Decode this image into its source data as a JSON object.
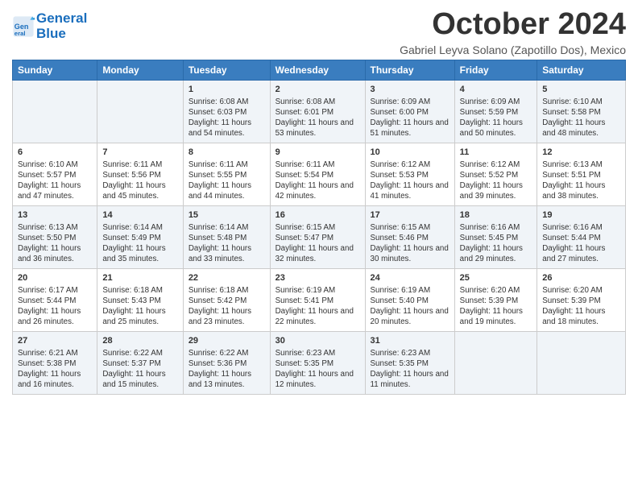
{
  "logo": {
    "line1": "General",
    "line2": "Blue"
  },
  "title": "October 2024",
  "subtitle": "Gabriel Leyva Solano (Zapotillo Dos), Mexico",
  "days_of_week": [
    "Sunday",
    "Monday",
    "Tuesday",
    "Wednesday",
    "Thursday",
    "Friday",
    "Saturday"
  ],
  "weeks": [
    [
      {
        "day": "",
        "info": ""
      },
      {
        "day": "",
        "info": ""
      },
      {
        "day": "1",
        "info": "Sunrise: 6:08 AM\nSunset: 6:03 PM\nDaylight: 11 hours and 54 minutes."
      },
      {
        "day": "2",
        "info": "Sunrise: 6:08 AM\nSunset: 6:01 PM\nDaylight: 11 hours and 53 minutes."
      },
      {
        "day": "3",
        "info": "Sunrise: 6:09 AM\nSunset: 6:00 PM\nDaylight: 11 hours and 51 minutes."
      },
      {
        "day": "4",
        "info": "Sunrise: 6:09 AM\nSunset: 5:59 PM\nDaylight: 11 hours and 50 minutes."
      },
      {
        "day": "5",
        "info": "Sunrise: 6:10 AM\nSunset: 5:58 PM\nDaylight: 11 hours and 48 minutes."
      }
    ],
    [
      {
        "day": "6",
        "info": "Sunrise: 6:10 AM\nSunset: 5:57 PM\nDaylight: 11 hours and 47 minutes."
      },
      {
        "day": "7",
        "info": "Sunrise: 6:11 AM\nSunset: 5:56 PM\nDaylight: 11 hours and 45 minutes."
      },
      {
        "day": "8",
        "info": "Sunrise: 6:11 AM\nSunset: 5:55 PM\nDaylight: 11 hours and 44 minutes."
      },
      {
        "day": "9",
        "info": "Sunrise: 6:11 AM\nSunset: 5:54 PM\nDaylight: 11 hours and 42 minutes."
      },
      {
        "day": "10",
        "info": "Sunrise: 6:12 AM\nSunset: 5:53 PM\nDaylight: 11 hours and 41 minutes."
      },
      {
        "day": "11",
        "info": "Sunrise: 6:12 AM\nSunset: 5:52 PM\nDaylight: 11 hours and 39 minutes."
      },
      {
        "day": "12",
        "info": "Sunrise: 6:13 AM\nSunset: 5:51 PM\nDaylight: 11 hours and 38 minutes."
      }
    ],
    [
      {
        "day": "13",
        "info": "Sunrise: 6:13 AM\nSunset: 5:50 PM\nDaylight: 11 hours and 36 minutes."
      },
      {
        "day": "14",
        "info": "Sunrise: 6:14 AM\nSunset: 5:49 PM\nDaylight: 11 hours and 35 minutes."
      },
      {
        "day": "15",
        "info": "Sunrise: 6:14 AM\nSunset: 5:48 PM\nDaylight: 11 hours and 33 minutes."
      },
      {
        "day": "16",
        "info": "Sunrise: 6:15 AM\nSunset: 5:47 PM\nDaylight: 11 hours and 32 minutes."
      },
      {
        "day": "17",
        "info": "Sunrise: 6:15 AM\nSunset: 5:46 PM\nDaylight: 11 hours and 30 minutes."
      },
      {
        "day": "18",
        "info": "Sunrise: 6:16 AM\nSunset: 5:45 PM\nDaylight: 11 hours and 29 minutes."
      },
      {
        "day": "19",
        "info": "Sunrise: 6:16 AM\nSunset: 5:44 PM\nDaylight: 11 hours and 27 minutes."
      }
    ],
    [
      {
        "day": "20",
        "info": "Sunrise: 6:17 AM\nSunset: 5:44 PM\nDaylight: 11 hours and 26 minutes."
      },
      {
        "day": "21",
        "info": "Sunrise: 6:18 AM\nSunset: 5:43 PM\nDaylight: 11 hours and 25 minutes."
      },
      {
        "day": "22",
        "info": "Sunrise: 6:18 AM\nSunset: 5:42 PM\nDaylight: 11 hours and 23 minutes."
      },
      {
        "day": "23",
        "info": "Sunrise: 6:19 AM\nSunset: 5:41 PM\nDaylight: 11 hours and 22 minutes."
      },
      {
        "day": "24",
        "info": "Sunrise: 6:19 AM\nSunset: 5:40 PM\nDaylight: 11 hours and 20 minutes."
      },
      {
        "day": "25",
        "info": "Sunrise: 6:20 AM\nSunset: 5:39 PM\nDaylight: 11 hours and 19 minutes."
      },
      {
        "day": "26",
        "info": "Sunrise: 6:20 AM\nSunset: 5:39 PM\nDaylight: 11 hours and 18 minutes."
      }
    ],
    [
      {
        "day": "27",
        "info": "Sunrise: 6:21 AM\nSunset: 5:38 PM\nDaylight: 11 hours and 16 minutes."
      },
      {
        "day": "28",
        "info": "Sunrise: 6:22 AM\nSunset: 5:37 PM\nDaylight: 11 hours and 15 minutes."
      },
      {
        "day": "29",
        "info": "Sunrise: 6:22 AM\nSunset: 5:36 PM\nDaylight: 11 hours and 13 minutes."
      },
      {
        "day": "30",
        "info": "Sunrise: 6:23 AM\nSunset: 5:35 PM\nDaylight: 11 hours and 12 minutes."
      },
      {
        "day": "31",
        "info": "Sunrise: 6:23 AM\nSunset: 5:35 PM\nDaylight: 11 hours and 11 minutes."
      },
      {
        "day": "",
        "info": ""
      },
      {
        "day": "",
        "info": ""
      }
    ]
  ]
}
